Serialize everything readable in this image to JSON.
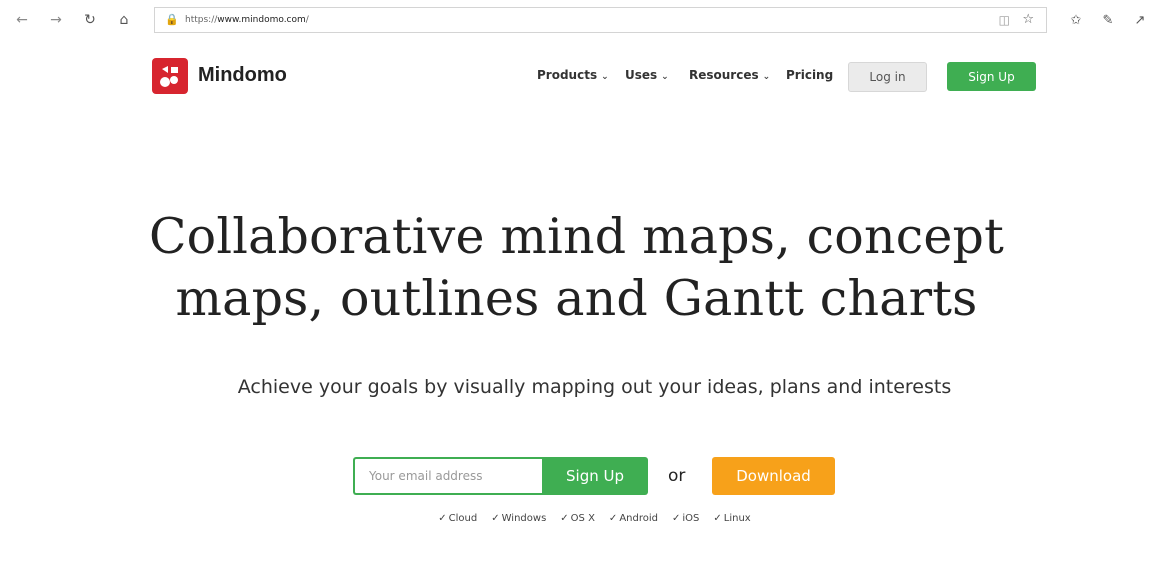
{
  "browser": {
    "url_prefix": "https://",
    "url_host": "www.mindomo.com",
    "url_suffix": "/"
  },
  "header": {
    "brand": "Mindomo",
    "menu": [
      {
        "label": "Products",
        "has_dropdown": true
      },
      {
        "label": "Uses",
        "has_dropdown": true
      },
      {
        "label": "Resources",
        "has_dropdown": true
      },
      {
        "label": "Pricing",
        "has_dropdown": false
      }
    ],
    "login_label": "Log in",
    "signup_label": "Sign Up"
  },
  "hero": {
    "title_line1": "Collaborative mind maps, concept",
    "title_line2": "maps, outlines and Gantt charts",
    "subtitle": "Achieve your goals by visually mapping out your ideas, plans and interests"
  },
  "cta": {
    "email_placeholder": "Your email address",
    "signup_label": "Sign Up",
    "or_label": "or",
    "download_label": "Download"
  },
  "platforms": [
    "Cloud",
    "Windows",
    "OS X",
    "Android",
    "iOS",
    "Linux"
  ],
  "colors": {
    "brand_red": "#d7252f",
    "green": "#3fae52",
    "orange": "#f7a11a"
  }
}
